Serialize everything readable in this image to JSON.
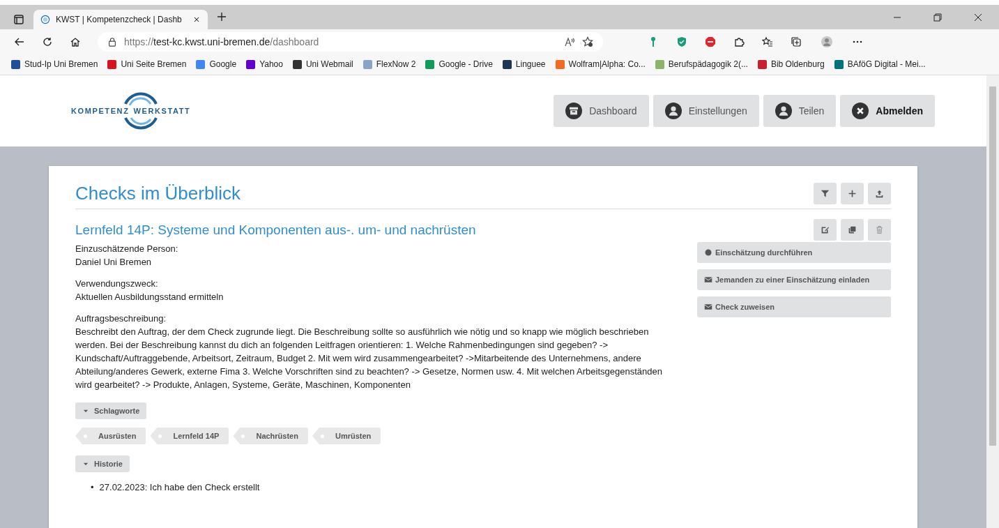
{
  "browser": {
    "tabs": [
      {
        "title": "KWST | Kompetenzcheck | Dashb",
        "selected": true
      }
    ],
    "url": {
      "scheme": "https://",
      "host": "test-kc.kwst.uni-bremen.de",
      "path": "/dashboard"
    },
    "bookmarks": [
      {
        "label": "Stud-Ip Uni Bremen",
        "color": "#1f4e9c"
      },
      {
        "label": "Uni Seite Bremen",
        "color": "#d7141e"
      },
      {
        "label": "Google",
        "color": "#4285f4"
      },
      {
        "label": "Yahoo",
        "color": "#6001d2"
      },
      {
        "label": "Uni Webmail",
        "color": "#333333"
      },
      {
        "label": "FlexNow 2",
        "color": "#8aa4c8"
      },
      {
        "label": "Google - Drive",
        "color": "#0f9d58"
      },
      {
        "label": "Linguee",
        "color": "#1d3557"
      },
      {
        "label": "Wolfram|Alpha: Co...",
        "color": "#f26a21"
      },
      {
        "label": "Berufspädagogik 2(...",
        "color": "#8db36b"
      },
      {
        "label": "Bib Oldenburg",
        "color": "#c8202f"
      },
      {
        "label": "BAföG Digital - Mei...",
        "color": "#00737a"
      }
    ]
  },
  "header": {
    "logo": {
      "left": "KOMPETENZ",
      "right": "WERKSTATT"
    },
    "nav": [
      {
        "label": "Dashboard",
        "kind": "dashboard",
        "bold": false
      },
      {
        "label": "Einstellungen",
        "kind": "user",
        "bold": false
      },
      {
        "label": "Teilen",
        "kind": "user",
        "bold": false
      },
      {
        "label": "Abmelden",
        "kind": "logout",
        "bold": true
      }
    ]
  },
  "card": {
    "title": "Checks im Überblick",
    "tools": [
      {
        "kind": "filter",
        "disabled": false
      },
      {
        "kind": "add",
        "disabled": false
      },
      {
        "kind": "upload",
        "disabled": false
      }
    ],
    "check": {
      "title": "Lernfeld 14P: Systeme und Komponenten aus-. um- und nachrüsten",
      "tools": [
        {
          "kind": "edit",
          "disabled": false
        },
        {
          "kind": "copy",
          "disabled": false
        },
        {
          "kind": "delete",
          "disabled": true
        }
      ],
      "fields": [
        {
          "label": "Einzuschätzende Person:",
          "value": "Daniel Uni Bremen"
        },
        {
          "label": "Verwendungszweck:",
          "value": "Aktuellen Ausbildungsstand ermitteln"
        },
        {
          "label": "Auftragsbeschreibung:",
          "value": "Beschreibt den Auftrag, der dem Check zugrunde liegt. Die Beschreibung sollte so ausführlich wie nötig und so knapp wie möglich beschrieben werden. Bei der Beschreibung kannst du dich an folgenden Leitfragen orientieren: 1. Welche Rahmenbedingungen sind gegeben? -> Kundschaft/Auftraggebende, Arbeitsort, Zeitraum, Budget 2. Mit wem wird zusammengearbeitet? ->Mitarbeitende des Unternehmens, andere Abteilung/anderes Gewerk, externe Fima 3. Welche Vorschriften sind zu beachten? -> Gesetze, Normen usw. 4. Mit welchen Arbeitsgegenständen wird gearbeitet? -> Produkte, Anlagen, Systeme, Geräte, Maschinen, Komponenten"
        }
      ],
      "actions": [
        {
          "label": "Einschätzung durchführen",
          "kind": "circle"
        },
        {
          "label": "Jemanden zu einer Einschätzung einladen",
          "kind": "mail"
        },
        {
          "label": "Check zuweisen",
          "kind": "mail"
        }
      ],
      "tags_toggle": {
        "label": "Schlagworte",
        "expanded": true
      },
      "tags": [
        "Ausrüsten",
        "Lernfeld 14P",
        "Nachrüsten",
        "Umrüsten"
      ],
      "history_toggle": {
        "label": "Historie",
        "expanded": true
      },
      "history": [
        {
          "bullet": "•",
          "text": "27.02.2023: Ich habe den Check erstellt"
        }
      ]
    }
  }
}
